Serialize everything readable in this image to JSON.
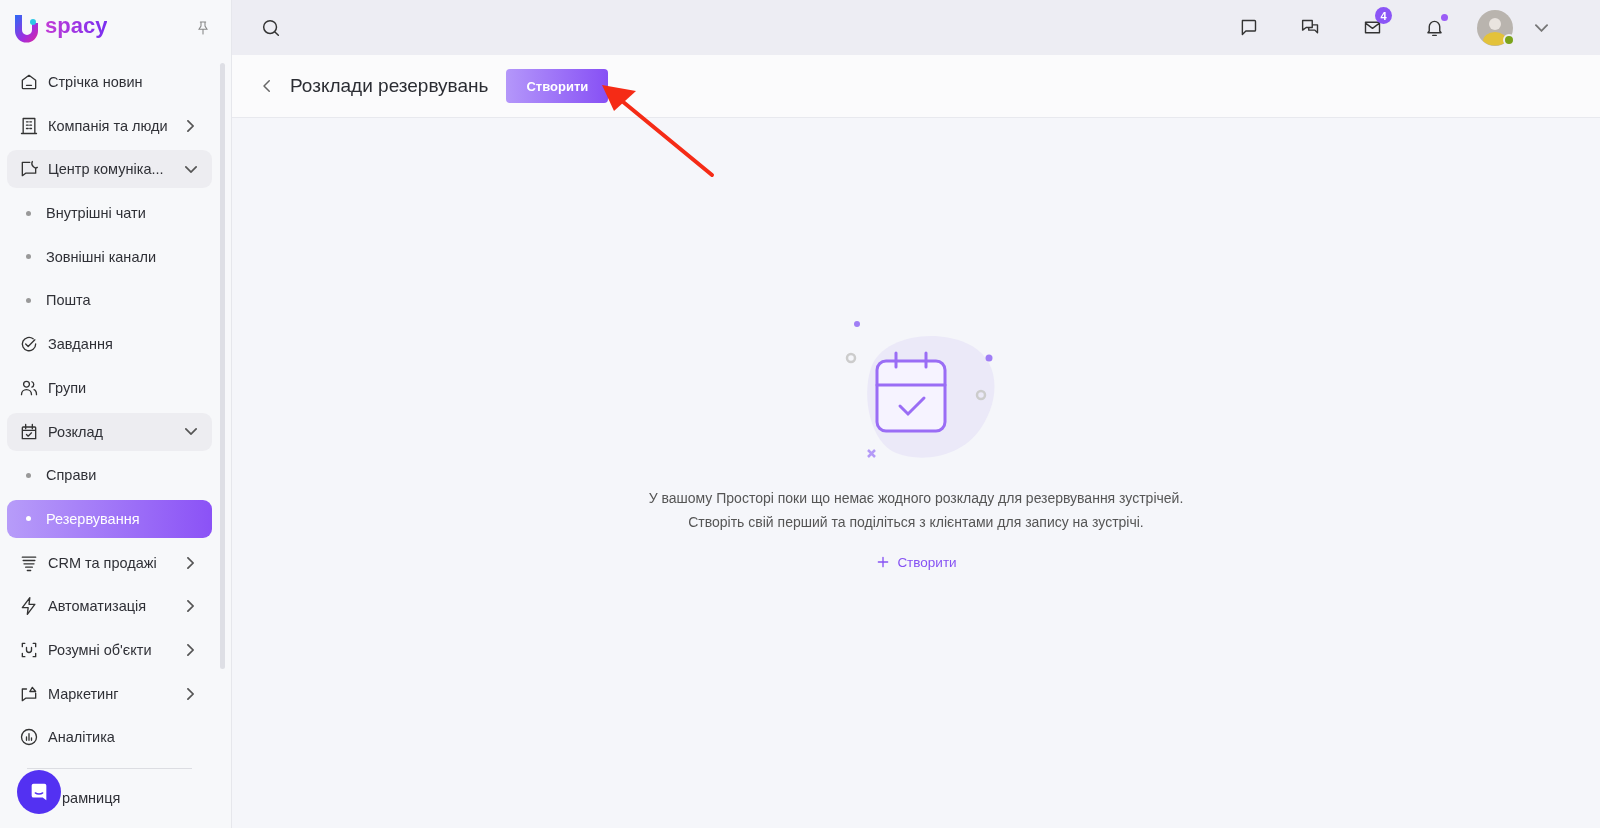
{
  "logo": {
    "text": "spacy"
  },
  "sidebar": {
    "items": [
      {
        "label": "Стрічка новин",
        "selected": false
      },
      {
        "label": "Компанія та люди",
        "selected": false,
        "expanded": false
      },
      {
        "label": "Центр комуніка...",
        "selected": false,
        "expanded": true,
        "children": [
          {
            "label": "Внутрішні чати",
            "selected": false
          },
          {
            "label": "Зовнішні канали",
            "selected": false
          },
          {
            "label": "Пошта",
            "selected": false
          }
        ]
      },
      {
        "label": "Завдання",
        "selected": false
      },
      {
        "label": "Групи",
        "selected": false
      },
      {
        "label": "Розклад",
        "selected": false,
        "expanded": true,
        "children": [
          {
            "label": "Справи",
            "selected": false
          },
          {
            "label": "Резервування",
            "selected": true
          }
        ]
      },
      {
        "label": "CRM та продажі",
        "selected": false,
        "expanded": false
      },
      {
        "label": "Автоматизація",
        "selected": false,
        "expanded": false
      },
      {
        "label": "Розумні об'єкти",
        "selected": false,
        "expanded": false
      },
      {
        "label": "Маркетинг",
        "selected": false,
        "expanded": false
      },
      {
        "label": "Аналітика",
        "selected": false
      }
    ],
    "footer_item": {
      "label": "рамниця",
      "selected": false
    }
  },
  "topbar": {
    "mail_badge": "4",
    "notifications_unread": true,
    "user_online": true
  },
  "page": {
    "title": "Розклади резервувань",
    "create_button": "Створити"
  },
  "empty_state": {
    "lines": [
      "У вашому Просторі поки що немає жодного розкладу для резервування зустрічей.",
      "Створіть свій перший та поділіться з клієнтами для запису на зустрічі."
    ],
    "action": "Створити"
  }
}
